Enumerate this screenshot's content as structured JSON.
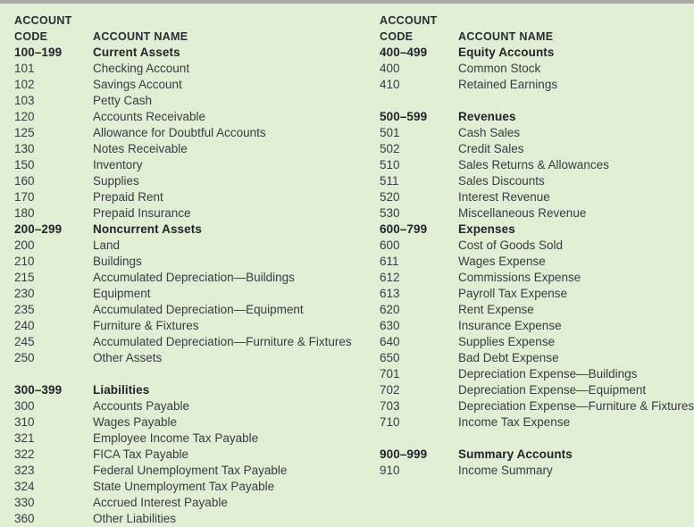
{
  "page": {
    "background_color": "#e0efd4",
    "top_rule_color": "#a8aaa6",
    "text_color": "#35353c",
    "heading_color": "#23232a"
  },
  "headers": {
    "account_code_line1": "ACCOUNT",
    "account_code_line2": "CODE",
    "account_name": "ACCOUNT NAME"
  },
  "left_column": {
    "header": {
      "code_line1": "ACCOUNT",
      "code_line2": "CODE",
      "name": "ACCOUNT NAME"
    },
    "rows": [
      {
        "code": "100–199",
        "name": "Current Assets",
        "group": true
      },
      {
        "code": "101",
        "name": "Checking Account",
        "group": false
      },
      {
        "code": "102",
        "name": "Savings Account",
        "group": false
      },
      {
        "code": "103",
        "name": "Petty Cash",
        "group": false
      },
      {
        "code": "120",
        "name": "Accounts Receivable",
        "group": false
      },
      {
        "code": "125",
        "name": "Allowance for Doubtful Accounts",
        "group": false
      },
      {
        "code": "130",
        "name": "Notes Receivable",
        "group": false
      },
      {
        "code": "150",
        "name": "Inventory",
        "group": false
      },
      {
        "code": "160",
        "name": "Supplies",
        "group": false
      },
      {
        "code": "170",
        "name": "Prepaid Rent",
        "group": false
      },
      {
        "code": "180",
        "name": "Prepaid Insurance",
        "group": false
      },
      {
        "code": "200–299",
        "name": "Noncurrent Assets",
        "group": true
      },
      {
        "code": "200",
        "name": "Land",
        "group": false
      },
      {
        "code": "210",
        "name": "Buildings",
        "group": false
      },
      {
        "code": "215",
        "name": "Accumulated Depreciation—Buildings",
        "group": false
      },
      {
        "code": "230",
        "name": "Equipment",
        "group": false
      },
      {
        "code": "235",
        "name": "Accumulated Depreciation—Equipment",
        "group": false
      },
      {
        "code": "240",
        "name": "Furniture & Fixtures",
        "group": false
      },
      {
        "code": "245",
        "name": "Accumulated Depreciation—Furniture & Fixtures",
        "group": false
      },
      {
        "code": "250",
        "name": "Other Assets",
        "group": false
      },
      {
        "code": "",
        "name": "",
        "group": false,
        "spacer": true
      },
      {
        "code": "300–399",
        "name": "Liabilities",
        "group": true
      },
      {
        "code": "300",
        "name": "Accounts Payable",
        "group": false
      },
      {
        "code": "310",
        "name": "Wages Payable",
        "group": false
      },
      {
        "code": "321",
        "name": "Employee Income Tax Payable",
        "group": false
      },
      {
        "code": "322",
        "name": "FICA Tax Payable",
        "group": false
      },
      {
        "code": "323",
        "name": "Federal Unemployment Tax Payable",
        "group": false
      },
      {
        "code": "324",
        "name": "State Unemployment Tax Payable",
        "group": false
      },
      {
        "code": "330",
        "name": "Accrued Interest Payable",
        "group": false
      },
      {
        "code": "360",
        "name": "Other Liabilities",
        "group": false
      }
    ]
  },
  "right_column": {
    "header": {
      "code_line1": "ACCOUNT",
      "code_line2": "CODE",
      "name": "ACCOUNT NAME"
    },
    "rows": [
      {
        "code": "400–499",
        "name": "Equity Accounts",
        "group": true
      },
      {
        "code": "400",
        "name": "Common Stock",
        "group": false
      },
      {
        "code": "410",
        "name": "Retained Earnings",
        "group": false
      },
      {
        "code": "",
        "name": "",
        "group": false,
        "spacer": true
      },
      {
        "code": "500–599",
        "name": "Revenues",
        "group": true
      },
      {
        "code": "501",
        "name": "Cash Sales",
        "group": false
      },
      {
        "code": "502",
        "name": "Credit Sales",
        "group": false
      },
      {
        "code": "510",
        "name": "Sales Returns & Allowances",
        "group": false
      },
      {
        "code": "511",
        "name": "Sales Discounts",
        "group": false
      },
      {
        "code": "520",
        "name": "Interest Revenue",
        "group": false
      },
      {
        "code": "530",
        "name": "Miscellaneous Revenue",
        "group": false
      },
      {
        "code": "600–799",
        "name": "Expenses",
        "group": true
      },
      {
        "code": "600",
        "name": "Cost of Goods Sold",
        "group": false
      },
      {
        "code": "611",
        "name": "Wages Expense",
        "group": false
      },
      {
        "code": "612",
        "name": "Commissions Expense",
        "group": false
      },
      {
        "code": "613",
        "name": "Payroll Tax Expense",
        "group": false
      },
      {
        "code": "620",
        "name": "Rent Expense",
        "group": false
      },
      {
        "code": "630",
        "name": "Insurance Expense",
        "group": false
      },
      {
        "code": "640",
        "name": "Supplies Expense",
        "group": false
      },
      {
        "code": "650",
        "name": "Bad Debt Expense",
        "group": false
      },
      {
        "code": "701",
        "name": "Depreciation Expense—Buildings",
        "group": false
      },
      {
        "code": "702",
        "name": "Depreciation Expense—Equipment",
        "group": false
      },
      {
        "code": "703",
        "name": "Depreciation Expense—Furniture & Fixtures",
        "group": false
      },
      {
        "code": "710",
        "name": "Income Tax Expense",
        "group": false
      },
      {
        "code": "",
        "name": "",
        "group": false,
        "spacer": true
      },
      {
        "code": "900–999",
        "name": "Summary Accounts",
        "group": true
      },
      {
        "code": "910",
        "name": "Income Summary",
        "group": false
      }
    ]
  }
}
